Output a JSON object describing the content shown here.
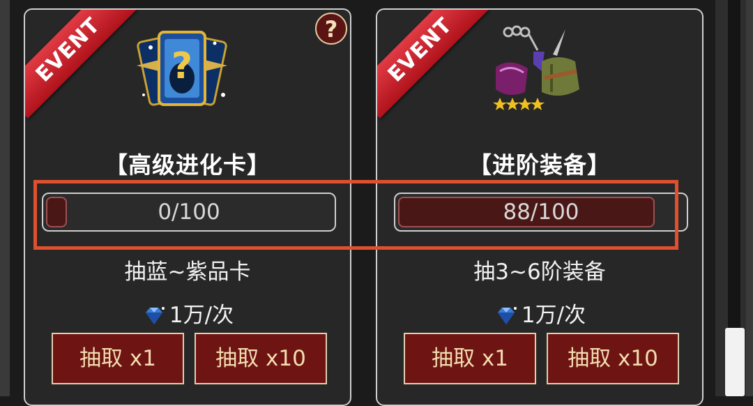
{
  "cards": [
    {
      "ribbon": "EVENT",
      "help": "?",
      "title": "【高级进化卡】",
      "progress_text": "0/100",
      "progress_value": 0,
      "desc": "抽蓝~紫品卡",
      "cost": "1万/次",
      "btn1": "抽取 x1",
      "btn10": "抽取 x10",
      "icon": "mystery-card-icon"
    },
    {
      "ribbon": "EVENT",
      "title": "【进阶装备】",
      "progress_text": "88/100",
      "progress_value": 88,
      "desc": "抽3~6阶装备",
      "cost": "1万/次",
      "btn1": "抽取 x1",
      "btn10": "抽取 x10",
      "icon": "equipment-set-icon"
    }
  ],
  "colors": {
    "highlight": "#e0502e",
    "button": "#6e1413",
    "ribbon": "#c8202a"
  }
}
